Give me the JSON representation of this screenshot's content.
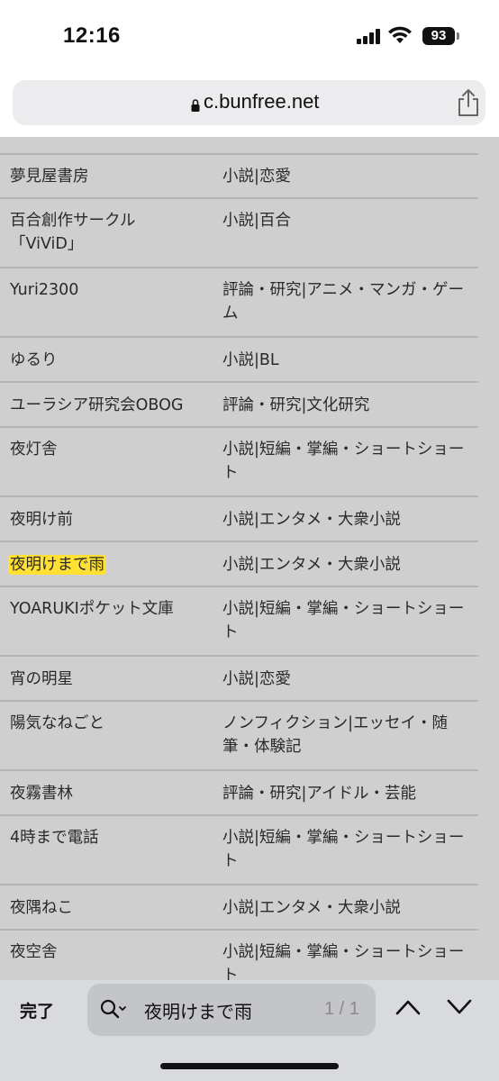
{
  "status_bar": {
    "time": "12:16",
    "battery": "93"
  },
  "browser": {
    "url": "c.bunfree.net"
  },
  "table_rows": [
    {
      "name": "……",
      "genre": "…"
    },
    {
      "name": "夢見屋書房",
      "genre": "小説|恋愛"
    },
    {
      "name": "百合創作サークル「ViViD」",
      "genre": "小説|百合"
    },
    {
      "name": "Yuri2300",
      "genre": "評論・研究|アニメ・マンガ・ゲーム"
    },
    {
      "name": "ゆるり",
      "genre": "小説|BL"
    },
    {
      "name": "ユーラシア研究会OBOG",
      "genre": "評論・研究|文化研究"
    },
    {
      "name": "夜灯舎",
      "genre": "小説|短編・掌編・ショートショート"
    },
    {
      "name": "夜明け前",
      "genre": "小説|エンタメ・大衆小説"
    },
    {
      "name": "夜明けまで雨",
      "genre": "小説|エンタメ・大衆小説",
      "highlighted": true
    },
    {
      "name": "YOARUKIポケット文庫",
      "genre": "小説|短編・掌編・ショートショート"
    },
    {
      "name": "宵の明星",
      "genre": "小説|恋愛"
    },
    {
      "name": "陽気なねごと",
      "genre": "ノンフィクション|エッセイ・随筆・体験記"
    },
    {
      "name": "夜霧書林",
      "genre": "評論・研究|アイドル・芸能"
    },
    {
      "name": "4時まで電話",
      "genre": "小説|短編・掌編・ショートショート"
    },
    {
      "name": "夜隅ねこ",
      "genre": "小説|エンタメ・大衆小説"
    },
    {
      "name": "夜空舎",
      "genre": "小説|短編・掌編・ショートショート"
    }
  ],
  "find_bar": {
    "done_label": "完了",
    "query": "夜明けまで雨",
    "match_count": "1 / 1",
    "search_icon": "magnifier-icon",
    "prev_icon": "chevron-up-icon",
    "next_icon": "chevron-down-icon"
  },
  "colors": {
    "highlight": "#ffe033",
    "page_dim": "#cfcfcf",
    "find_bar": "#d9dadd"
  }
}
